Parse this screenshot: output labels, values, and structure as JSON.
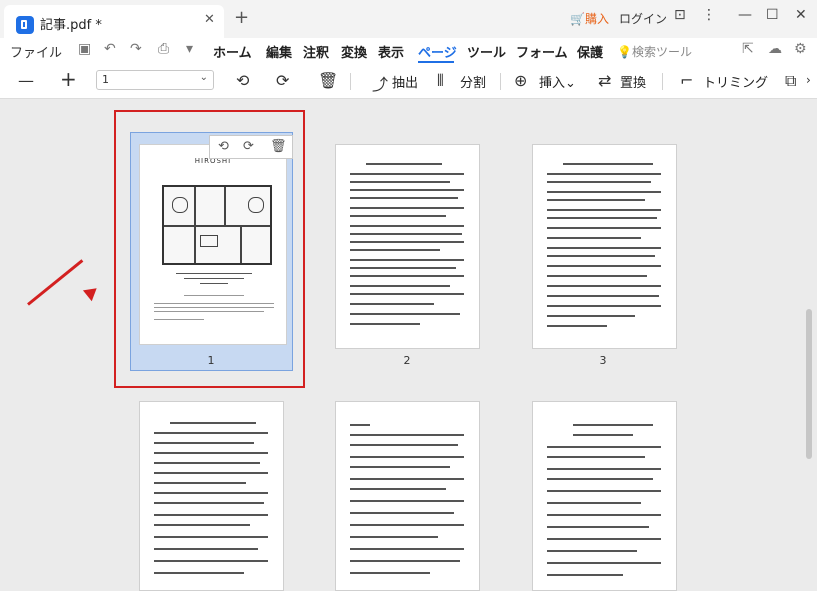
{
  "app": {
    "tab_title": "記事.pdf *",
    "buy_label": "購入",
    "login_label": "ログイン"
  },
  "menu": {
    "file": "ファイル",
    "items": [
      "ホーム",
      "編集",
      "注釈",
      "変換",
      "表示",
      "ページ",
      "ツール",
      "フォーム",
      "保護"
    ],
    "active": "ページ",
    "search_tool": "検索ツール"
  },
  "toolbar": {
    "page_value": "1",
    "extract": "抽出",
    "split": "分割",
    "insert": "挿入",
    "replace": "置換",
    "trim": "トリミング"
  },
  "thumbnails": {
    "page1": "1",
    "page2": "2",
    "page3": "3",
    "page1_title": "HIROSHI"
  },
  "colors": {
    "accent": "#1f6fe5",
    "highlight": "#d32020",
    "selection": "#c7d9f2"
  }
}
